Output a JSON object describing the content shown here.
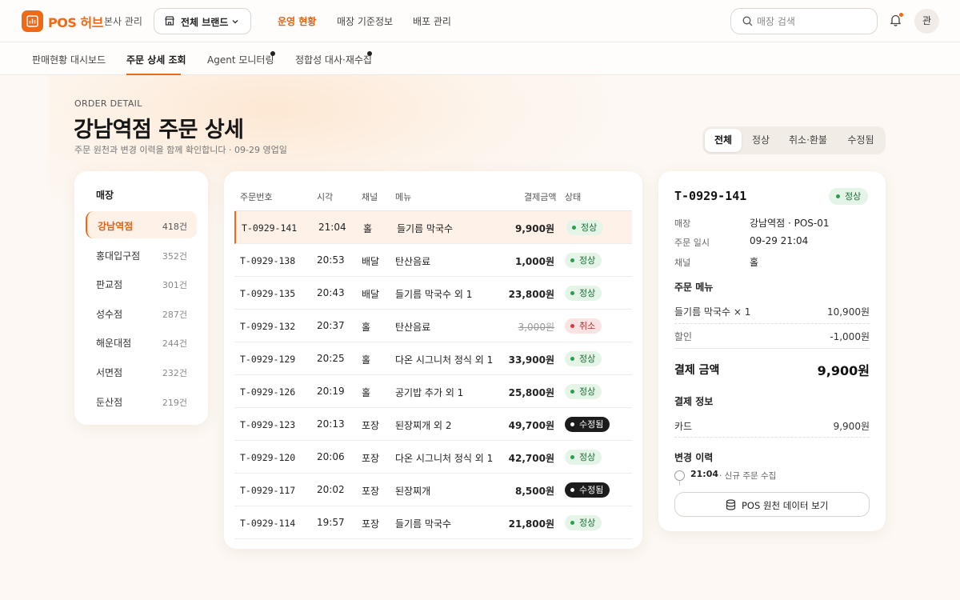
{
  "app": {
    "logo_text": "POS 허브",
    "hq_label": "본사 관리",
    "brand_select": "전체 브랜드",
    "nav": [
      "운영 현황",
      "매장 기준정보",
      "배포 관리"
    ],
    "search_placeholder": "매장 검색",
    "avatar": "관",
    "accent": "#f06a16"
  },
  "subtabs": [
    "판매현황 대시보드",
    "주문 상세 조회",
    "Agent 모니터링",
    "정합성 대사·재수집"
  ],
  "header": {
    "eyebrow": "ORDER DETAIL",
    "title": "강남역점 주문 상세",
    "subtitle": "주문 원천과 변경 이력을 함께 확인합니다 · 09-29 영업일"
  },
  "filters": [
    "전체",
    "정상",
    "취소·환불",
    "수정됨"
  ],
  "stores": {
    "title": "매장",
    "items": [
      {
        "name": "강남역점",
        "count": "418건"
      },
      {
        "name": "홍대입구점",
        "count": "352건"
      },
      {
        "name": "판교점",
        "count": "301건"
      },
      {
        "name": "성수점",
        "count": "287건"
      },
      {
        "name": "해운대점",
        "count": "244건"
      },
      {
        "name": "서면점",
        "count": "232건"
      },
      {
        "name": "둔산점",
        "count": "219건"
      }
    ]
  },
  "orders": {
    "columns": [
      "주문번호",
      "시각",
      "채널",
      "메뉴",
      "결제금액",
      "상태"
    ],
    "rows": [
      {
        "id": "T-0929-141",
        "time": "21:04",
        "channel": "홀",
        "menu": "들기름 막국수",
        "amount": "9,900원",
        "status": "정상"
      },
      {
        "id": "T-0929-138",
        "time": "20:53",
        "channel": "배달",
        "menu": "탄산음료",
        "amount": "1,000원",
        "status": "정상"
      },
      {
        "id": "T-0929-135",
        "time": "20:43",
        "channel": "배달",
        "menu": "들기름 막국수 외 1",
        "amount": "23,800원",
        "status": "정상"
      },
      {
        "id": "T-0929-132",
        "time": "20:37",
        "channel": "홀",
        "menu": "탄산음료",
        "amount": "3,000원",
        "status": "취소"
      },
      {
        "id": "T-0929-129",
        "time": "20:25",
        "channel": "홀",
        "menu": "다온 시그니처 정식 외 1",
        "amount": "33,900원",
        "status": "정상"
      },
      {
        "id": "T-0929-126",
        "time": "20:19",
        "channel": "홀",
        "menu": "공기밥 추가 외 1",
        "amount": "25,800원",
        "status": "정상"
      },
      {
        "id": "T-0929-123",
        "time": "20:13",
        "channel": "포장",
        "menu": "된장찌개 외 2",
        "amount": "49,700원",
        "status": "수정됨"
      },
      {
        "id": "T-0929-120",
        "time": "20:06",
        "channel": "포장",
        "menu": "다온 시그니처 정식 외 1",
        "amount": "42,700원",
        "status": "정상"
      },
      {
        "id": "T-0929-117",
        "time": "20:02",
        "channel": "포장",
        "menu": "된장찌개",
        "amount": "8,500원",
        "status": "수정됨"
      },
      {
        "id": "T-0929-114",
        "time": "19:57",
        "channel": "포장",
        "menu": "들기름 막국수",
        "amount": "21,800원",
        "status": "정상"
      }
    ]
  },
  "detail": {
    "id": "T-0929-141",
    "status": "정상",
    "fields": [
      {
        "k": "매장",
        "v": "강남역점 · POS-01"
      },
      {
        "k": "주문 일시",
        "v": "09-29 21:04"
      },
      {
        "k": "채널",
        "v": "홀"
      }
    ],
    "menu_title": "주문 메뉴",
    "menu_line": {
      "name": "들기름 막국수 × 1",
      "price": "10,900원"
    },
    "discount": {
      "name": "할인",
      "price": "-1,000원"
    },
    "total_label": "결제 금액",
    "total_value": "9,900원",
    "payment_title": "결제 정보",
    "payment": {
      "method": "카드",
      "amount": "9,900원"
    },
    "history_title": "변경 이력",
    "history": {
      "time": "21:04",
      "desc": "· 신규 주문 수집"
    },
    "raw_button": "POS 원천 데이터 보기"
  }
}
